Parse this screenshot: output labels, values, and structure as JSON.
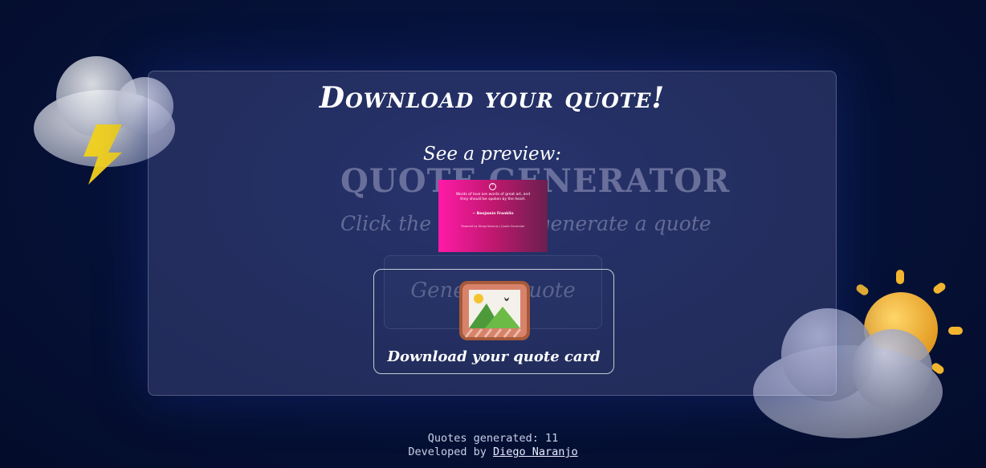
{
  "background_app": {
    "title": "Quote Generator",
    "subtitle": "Click the button to generate a quote",
    "generate_button_label": "Generate quote"
  },
  "modal": {
    "title": "Download your quote!",
    "preview_label": "See a preview:",
    "preview_card": {
      "quote": "Words of love are words of great art, and they should be spoken by the heart.",
      "author": "~ Benjamin Franklin",
      "footer": "Powered by Diego Naranjo | Quote Generator"
    },
    "download_button_label": "Download your quote card",
    "download_icon": "image-frame-icon"
  },
  "footer": {
    "counter_label": "Quotes generated:",
    "counter_value": "11",
    "developed_by": "Developed by",
    "developer_link": "Diego Naranjo"
  },
  "icons": {
    "left": "thunderstorm-icon",
    "right": "sun-behind-cloud-icon"
  },
  "colors": {
    "background": "#06123a",
    "card_gradient_start": "#ff1aa8",
    "card_gradient_end": "#6a1f4f",
    "lightning": "#f2d21c",
    "sun": "#f6b82a"
  }
}
